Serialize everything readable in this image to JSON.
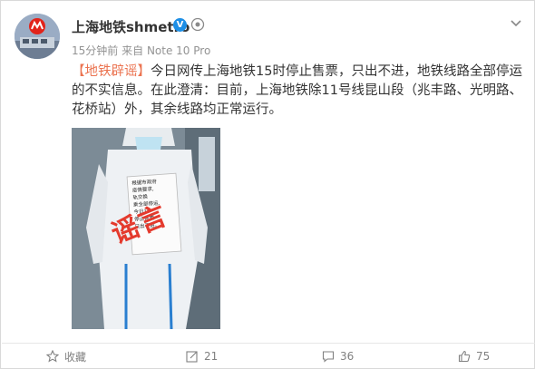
{
  "user": {
    "name": "上海地铁shmetro",
    "verified_badge": "V"
  },
  "post_meta": {
    "time": "15分钟前",
    "source_prefix": "来自",
    "device": "Note 10 Pro"
  },
  "post": {
    "tag": "【地铁辟谣】",
    "text": "今日网传上海地铁15时停止售票，只出不进，地铁线路全部停运的不实信息。在此澄清：目前，上海地铁除11号线昆山段（兆丰路、光明路、花桥站）外，其余线路均正常运行。"
  },
  "photo": {
    "stamp_text": "谣言",
    "notice_lines": [
      "根据市政府",
      "疫情要求,",
      "轨交换",
      "乘全部停运,",
      "今日15",
      "停止售票",
      "只出不进。"
    ]
  },
  "actions": {
    "favorite_label": "收藏",
    "repost_count": "21",
    "comment_count": "36",
    "like_count": "75"
  },
  "colors": {
    "accent": "#eb7350",
    "verified": "#1e8fe6",
    "text": "#333333",
    "meta": "#939393"
  },
  "icons": [
    "avatar-metro-logo",
    "verified-icon",
    "badge-icon",
    "chevron-down-icon",
    "star-icon",
    "repost-icon",
    "comment-icon",
    "like-icon"
  ]
}
